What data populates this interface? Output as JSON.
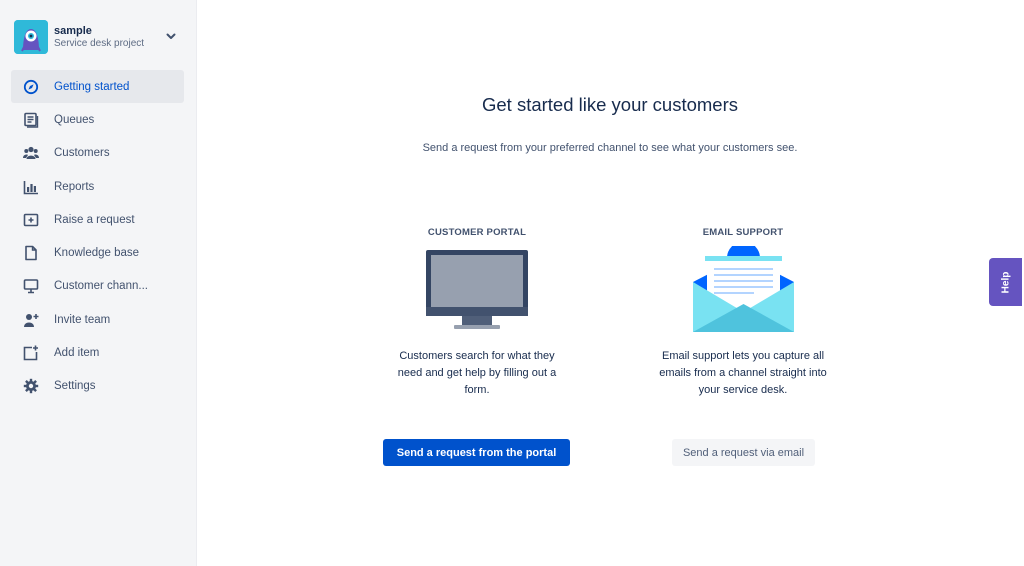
{
  "project": {
    "name": "sample",
    "type": "Service desk project",
    "avatar_color": "#2fb9d9"
  },
  "sidebar": {
    "items": [
      {
        "label": "Getting started",
        "icon": "compass-icon",
        "active": true
      },
      {
        "label": "Queues",
        "icon": "queues-icon"
      },
      {
        "label": "Customers",
        "icon": "people-icon"
      },
      {
        "label": "Reports",
        "icon": "graph-bar-icon"
      },
      {
        "label": "Raise a request",
        "icon": "add-request-icon"
      },
      {
        "label": "Knowledge base",
        "icon": "page-icon"
      },
      {
        "label": "Customer chann...",
        "icon": "monitor-icon"
      },
      {
        "label": "Invite team",
        "icon": "invite-person-icon"
      },
      {
        "label": "Add item",
        "icon": "add-item-icon"
      },
      {
        "label": "Settings",
        "icon": "gear-icon"
      }
    ]
  },
  "main": {
    "title": "Get started like your customers",
    "subtitle": "Send a request from your preferred channel to see what your customers see.",
    "portal": {
      "title": "CUSTOMER PORTAL",
      "description_lines": [
        "Customers search for what they",
        "need and get help by filling out a",
        "form."
      ],
      "button": "Send a request from the portal"
    },
    "email": {
      "title": "EMAIL SUPPORT",
      "description_lines": [
        "Email support lets you capture all",
        "emails from a channel straight into",
        "your service desk."
      ],
      "button": "Send a request via email"
    }
  },
  "help": {
    "label": "Help",
    "color": "#6554c0"
  },
  "colors": {
    "primary": "#0052cc",
    "active_nav_bg": "#e6e8ec",
    "sidebar_bg": "#f4f5f7"
  }
}
